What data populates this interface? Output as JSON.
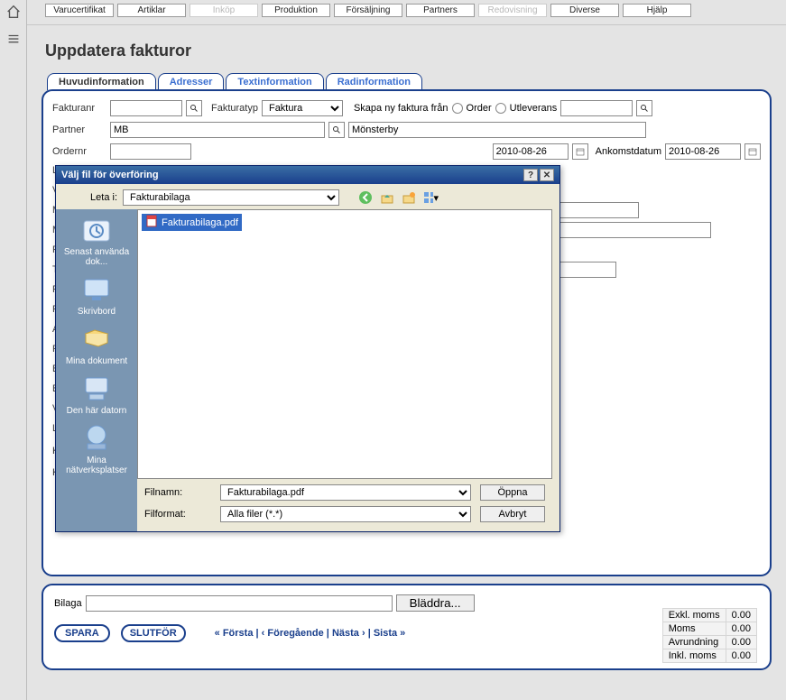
{
  "menu": {
    "items": [
      {
        "label": "Varucertifikat",
        "disabled": false
      },
      {
        "label": "Artiklar",
        "disabled": false
      },
      {
        "label": "Inköp",
        "disabled": true
      },
      {
        "label": "Produktion",
        "disabled": false
      },
      {
        "label": "Försäljning",
        "disabled": false
      },
      {
        "label": "Partners",
        "disabled": false
      },
      {
        "label": "Redovisning",
        "disabled": true
      },
      {
        "label": "Diverse",
        "disabled": false
      },
      {
        "label": "Hjälp",
        "disabled": false
      }
    ]
  },
  "page": {
    "title": "Uppdatera fakturor"
  },
  "tabs": {
    "items": [
      {
        "label": "Huvudinformation",
        "active": true
      },
      {
        "label": "Adresser",
        "active": false
      },
      {
        "label": "Textinformation",
        "active": false
      },
      {
        "label": "Radinformation",
        "active": false
      }
    ]
  },
  "form": {
    "fakturanr_label": "Fakturanr",
    "fakturanr_value": "",
    "fakturatyp_label": "Fakturatyp",
    "fakturatyp_value": "Faktura",
    "skapa_ny_label": "Skapa ny faktura från",
    "order_label": "Order",
    "utleverans_label": "Utleverans",
    "utleverans_value": "",
    "partner_label": "Partner",
    "partner_value": "MB",
    "partner_name": "Mönsterby",
    "ordernr_label": "Ordernr",
    "date1": "2010-08-26",
    "ankomst_label": "Ankomstdatum",
    "ankomst_value": "2010-08-26",
    "kund_kost_label": "Kunds kostnadsställe",
    "kund_ord_label": "Kunds ordernummer",
    "obscured_labels": [
      "Lo",
      "Va",
      "M",
      "M",
      "Fa",
      "Tr",
      "Fi",
      "Fa",
      "A",
      "Fö",
      "Be",
      "Be",
      "Vi",
      "Le"
    ]
  },
  "bottom": {
    "bilaga_label": "Bilaga",
    "bilaga_value": "",
    "browse_label": "Bläddra...",
    "spara": "SPARA",
    "slutfor": "SLUTFÖR",
    "nav": {
      "first": "« Första",
      "prev": "‹ Föregående",
      "next": "Nästa ›",
      "last": "Sista »",
      "sep": " | "
    }
  },
  "totals": {
    "rows": [
      {
        "label": "Exkl. moms",
        "value": "0.00"
      },
      {
        "label": "Moms",
        "value": "0.00"
      },
      {
        "label": "Avrundning",
        "value": "0.00"
      },
      {
        "label": "Inkl. moms",
        "value": "0.00"
      }
    ]
  },
  "dialog": {
    "title": "Välj fil för överföring",
    "leta_i_label": "Leta i:",
    "leta_i_value": "Fakturabilaga",
    "places": [
      {
        "label": "Senast använda dok...",
        "icon": "recent"
      },
      {
        "label": "Skrivbord",
        "icon": "desktop"
      },
      {
        "label": "Mina dokument",
        "icon": "docs"
      },
      {
        "label": "Den här datorn",
        "icon": "computer"
      },
      {
        "label": "Mina nätverksplatser",
        "icon": "network"
      }
    ],
    "files": [
      {
        "name": "Fakturabilaga.pdf"
      }
    ],
    "filnamn_label": "Filnamn:",
    "filnamn_value": "Fakturabilaga.pdf",
    "filformat_label": "Filformat:",
    "filformat_value": "Alla filer (*.*)",
    "open_label": "Öppna",
    "cancel_label": "Avbryt"
  }
}
